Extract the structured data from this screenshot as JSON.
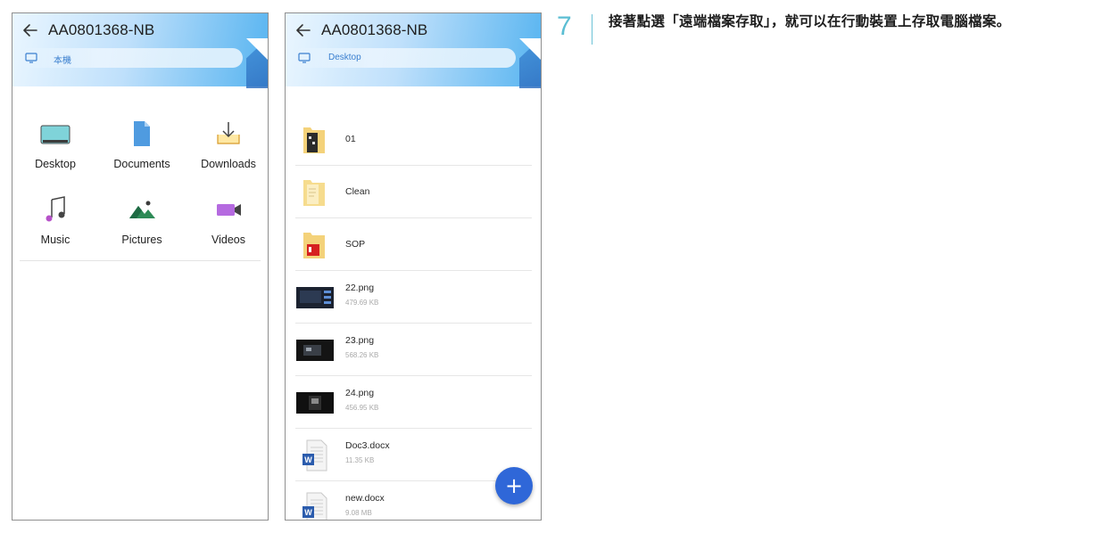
{
  "left_screen": {
    "title": "AA0801368-NB",
    "path": "本機",
    "folders": [
      {
        "label": "Desktop",
        "icon": "desktop-icon"
      },
      {
        "label": "Documents",
        "icon": "document-icon"
      },
      {
        "label": "Downloads",
        "icon": "download-icon"
      },
      {
        "label": "Music",
        "icon": "music-icon"
      },
      {
        "label": "Pictures",
        "icon": "pictures-icon"
      },
      {
        "label": "Videos",
        "icon": "video-icon"
      }
    ]
  },
  "right_screen": {
    "title": "AA0801368-NB",
    "path": "Desktop",
    "files": [
      {
        "name": "01",
        "size": "",
        "type": "folder"
      },
      {
        "name": "Clean",
        "size": "",
        "type": "folder"
      },
      {
        "name": "SOP",
        "size": "",
        "type": "folder"
      },
      {
        "name": "22.png",
        "size": "479.69 KB",
        "type": "image"
      },
      {
        "name": "23.png",
        "size": "568.26 KB",
        "type": "image"
      },
      {
        "name": "24.png",
        "size": "456.95 KB",
        "type": "image"
      },
      {
        "name": "Doc3.docx",
        "size": "11.35 KB",
        "type": "word"
      },
      {
        "name": "new.docx",
        "size": "9.08 MB",
        "type": "word"
      }
    ],
    "fab_label": "+"
  },
  "instruction": {
    "step": "7",
    "text": "接著點選「遠端檔案存取」，就可以在行動裝置上存取電腦檔案。"
  },
  "colors": {
    "accent": "#2f67d8",
    "header_gradient_end": "#57b4f0",
    "step_color": "#5bbed3"
  }
}
